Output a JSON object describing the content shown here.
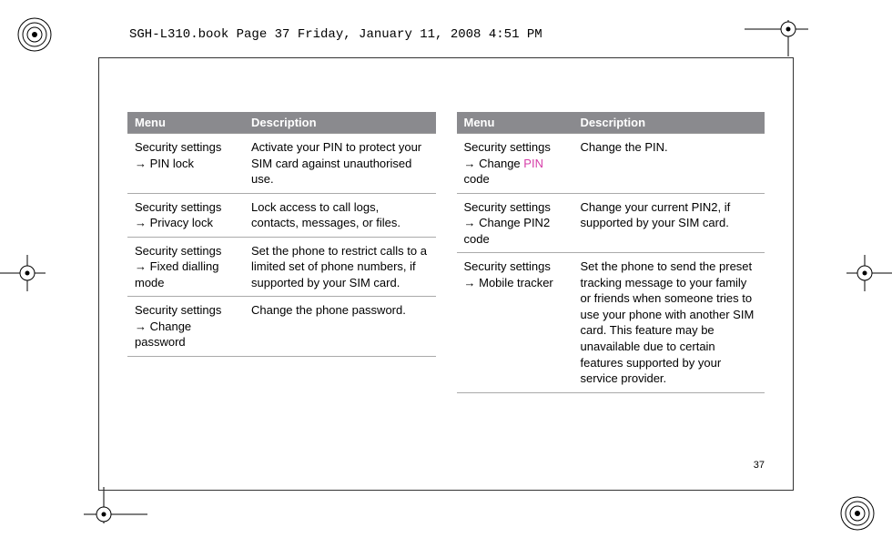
{
  "header": {
    "path_text": "SGH-L310.book  Page 37  Friday, January 11, 2008  4:51 PM"
  },
  "columns": {
    "left": {
      "header_menu": "Menu",
      "header_desc": "Description",
      "rows": [
        {
          "menu_prefix": "Security settings",
          "menu_suffix": "PIN lock",
          "desc": "Activate your PIN to protect your SIM card against unauthorised use."
        },
        {
          "menu_prefix": "Security settings",
          "menu_suffix": "Privacy lock",
          "desc": "Lock access to call logs, contacts, messages, or files."
        },
        {
          "menu_prefix": "Security settings",
          "menu_suffix": "Fixed dialling mode",
          "desc": "Set the phone to restrict calls to a limited set of phone numbers, if supported by your SIM card."
        },
        {
          "menu_prefix": "Security settings",
          "menu_suffix": "Change password",
          "desc": "Change the phone password."
        }
      ]
    },
    "right": {
      "header_menu": "Menu",
      "header_desc": "Description",
      "rows": [
        {
          "menu_prefix": "Security settings",
          "menu_mid": "Change ",
          "menu_pink": "PIN",
          "menu_after": " code",
          "desc": "Change the PIN."
        },
        {
          "menu_prefix": "Security settings",
          "menu_suffix": "Change PIN2 code",
          "desc": "Change your current PIN2, if supported by your SIM card."
        },
        {
          "menu_prefix": "Security settings",
          "menu_suffix": "Mobile tracker",
          "desc": "Set the phone to send the preset tracking message to your family or friends when someone tries to use your phone with another SIM card. This feature may be unavailable due to certain features supported by your service provider."
        }
      ]
    }
  },
  "page_number": "37",
  "arrow": "→"
}
